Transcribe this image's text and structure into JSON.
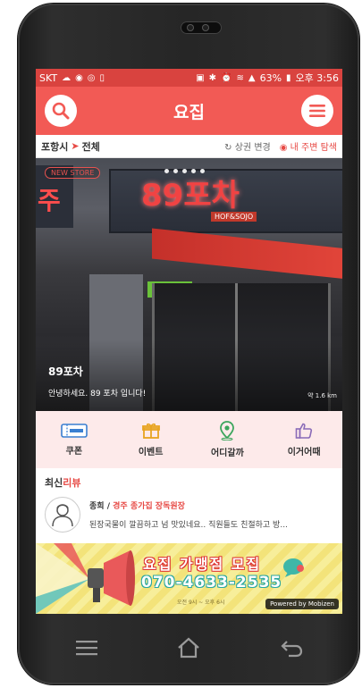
{
  "statusbar": {
    "carrier": "SKT",
    "battery": "63%",
    "time": "오후 3:56"
  },
  "appbar": {
    "title": "요집"
  },
  "location": {
    "city": "포항시",
    "area": "전체",
    "change_label": "상권 변경",
    "nearby_label": "내 주변 탐색"
  },
  "hero": {
    "badge": "NEW STORE",
    "sign_text": "89포차",
    "sign_sub": "HOF&SOJO",
    "left_sign": "주",
    "store_name": "89포차",
    "store_desc": "안녕하세요. 89 포차 입니다!",
    "distance": "약 1.6 km",
    "slide_count": 5
  },
  "menu": [
    {
      "label": "쿠폰",
      "icon": "coupon-icon"
    },
    {
      "label": "이벤트",
      "icon": "gift-icon"
    },
    {
      "label": "어디갈까",
      "icon": "map-pin-icon"
    },
    {
      "label": "이거어때",
      "icon": "thumbs-up-icon"
    }
  ],
  "reviews": {
    "header_prefix": "최신",
    "header_highlight": "리뷰",
    "items": [
      {
        "author": "종희",
        "store": "경주 종가집 장독원장",
        "text": "된장국물이 깔끔하고 넘 맛있네요.. 직원들도 친절하고 방..."
      }
    ]
  },
  "ad": {
    "title": "요집 가맹점 모집",
    "phone": "070-4633-2535",
    "hours": "오전 9시 ~ 오후 6시",
    "powered": "Powered by Mobizen"
  },
  "colors": {
    "primary": "#f25a55",
    "statusbar": "#d9433f",
    "accent_text": "#e74a45",
    "menu_bg": "#fdeaea"
  }
}
